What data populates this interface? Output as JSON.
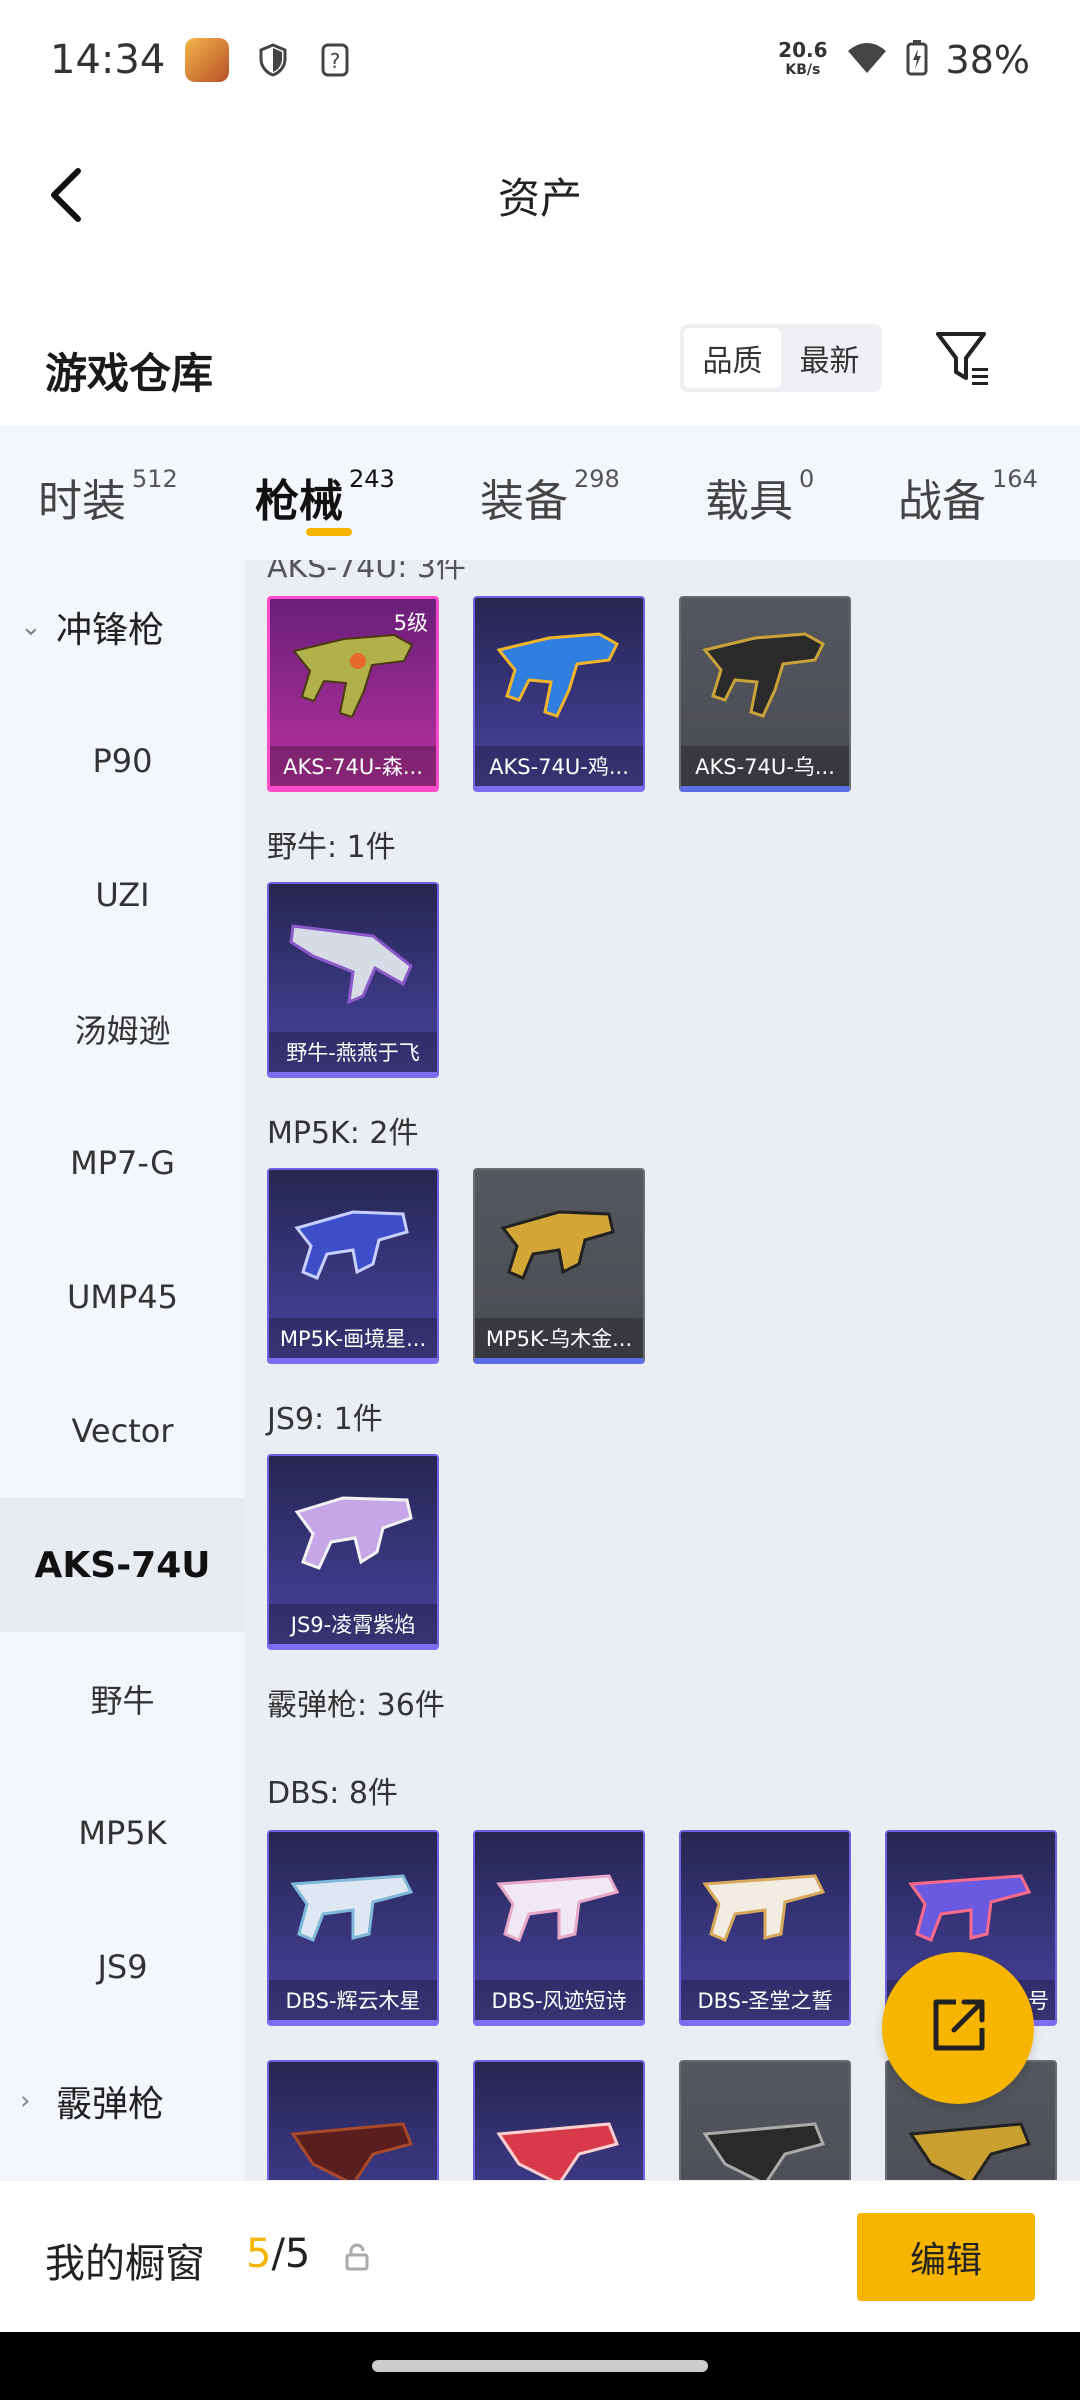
{
  "status_bar": {
    "time": "14:34",
    "net_speed_value": "20.6",
    "net_speed_unit": "KB/s",
    "battery": "38%",
    "icons": [
      "app-icon",
      "shield-icon",
      "question-icon",
      "wifi-icon",
      "battery-icon"
    ]
  },
  "header": {
    "title": "资产"
  },
  "section": {
    "title": "游戏仓库",
    "sort_options": [
      "品质",
      "最新"
    ],
    "selected_sort": "品质"
  },
  "tabs": [
    {
      "label": "时装",
      "count": "512"
    },
    {
      "label": "枪械",
      "count": "243"
    },
    {
      "label": "装备",
      "count": "298"
    },
    {
      "label": "载具",
      "count": "0"
    },
    {
      "label": "战备",
      "count": "164"
    }
  ],
  "active_tab": "枪械",
  "sidebar": {
    "group1": "冲锋枪",
    "items": [
      "P90",
      "UZI",
      "汤姆逊",
      "MP7-G",
      "UMP45",
      "Vector",
      "AKS-74U",
      "野牛",
      "MP5K",
      "JS9"
    ],
    "selected": "AKS-74U",
    "group2": "霰弹枪"
  },
  "content": {
    "top_partial_label": "AKS-74U: 3件",
    "aks_items": [
      {
        "name": "AKS-74U-森...",
        "level": "5级",
        "rarity": "pink"
      },
      {
        "name": "AKS-74U-鸡...",
        "rarity": "purple"
      },
      {
        "name": "AKS-74U-乌...",
        "rarity": "grey"
      }
    ],
    "bison_label": "野牛: 1件",
    "bison_items": [
      {
        "name": "野牛-燕燕于飞",
        "rarity": "purple"
      }
    ],
    "mp5k_label": "MP5K: 2件",
    "mp5k_items": [
      {
        "name": "MP5K-画境星...",
        "rarity": "purple"
      },
      {
        "name": "MP5K-乌木金...",
        "rarity": "grey"
      }
    ],
    "js9_label": "JS9: 1件",
    "js9_items": [
      {
        "name": "JS9-凌霄紫焰",
        "rarity": "purple"
      }
    ],
    "shotgun_label": "霰弹枪: 36件",
    "dbs_label": "DBS: 8件",
    "dbs_items": [
      {
        "name": "DBS-辉云木星",
        "rarity": "purple"
      },
      {
        "name": "DBS-风迹短诗",
        "rarity": "purple"
      },
      {
        "name": "DBS-圣堂之誓",
        "rarity": "purple"
      },
      {
        "name": "号",
        "rarity": "purple"
      }
    ]
  },
  "bottom_bar": {
    "label": "我的橱窗",
    "count_current": "5",
    "count_sep_total": "/5",
    "edit_label": "编辑"
  },
  "colors": {
    "accent": "#f5b400",
    "purple_card": "#3e3a8a",
    "pink_card": "#b8339e",
    "grey_card": "#4a4c52"
  }
}
